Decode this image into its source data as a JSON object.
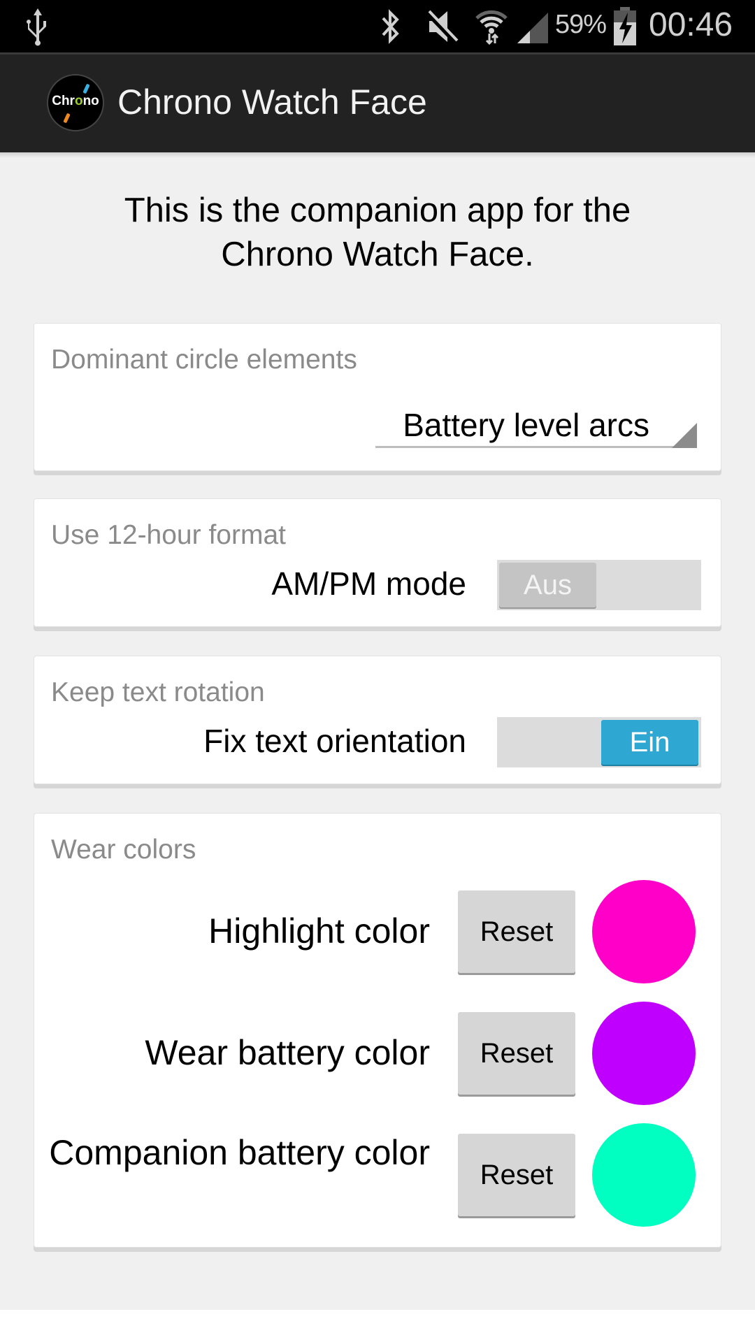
{
  "status_bar": {
    "icons": [
      "usb-icon",
      "bluetooth-icon",
      "mute-icon",
      "wifi-icon",
      "signal-icon",
      "battery-charging-icon"
    ],
    "battery_percent": "59%",
    "time": "00:46"
  },
  "action_bar": {
    "logo_text_a": "Chr",
    "logo_text_o": "o",
    "logo_text_b": "no",
    "title": "Chrono Watch Face"
  },
  "intro": {
    "line1": "This is the companion app for the",
    "line2": "Chrono Watch Face."
  },
  "cards": {
    "dominant": {
      "label": "Dominant circle elements",
      "selected_value": "Battery level arcs"
    },
    "hour_format": {
      "label": "Use 12-hour format",
      "row_label": "AM/PM mode",
      "switch_state": "off",
      "switch_text": "Aus"
    },
    "text_rotation": {
      "label": "Keep text rotation",
      "row_label": "Fix text orientation",
      "switch_state": "on",
      "switch_text": "Ein"
    },
    "wear_colors": {
      "label": "Wear colors",
      "rows": [
        {
          "label": "Highlight color",
          "reset_label": "Reset",
          "color": "#ff00c8"
        },
        {
          "label": "Wear battery color",
          "reset_label": "Reset",
          "color": "#c000ff"
        },
        {
          "label": "Companion battery color",
          "reset_label": "Reset",
          "color": "#00ffc0"
        }
      ]
    }
  },
  "colors": {
    "accent": "#2ea7d3",
    "action_bar_bg": "#222222",
    "page_bg": "#f0f0f0"
  }
}
